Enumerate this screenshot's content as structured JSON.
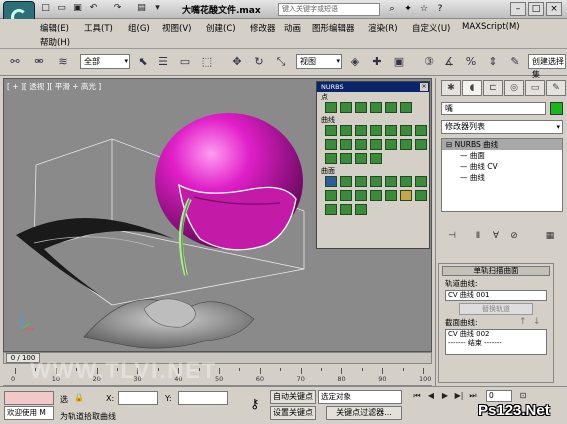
{
  "titlebar": {
    "title": "大嘴花酸文件.max",
    "search_placeholder": "键入关键字或短语"
  },
  "menu": {
    "row1": [
      "编辑(E)",
      "工具(T)",
      "组(G)",
      "视图(V)",
      "创建(C)",
      "修改器",
      "动画",
      "图形编辑器",
      "渲染(R)",
      "自定义(U)",
      "MAXScript(M)"
    ],
    "row2": [
      "帮助(H)"
    ]
  },
  "toolbar": {
    "selection_filter": "全部",
    "ref_coord": "视图",
    "named_selection": "创建选择集"
  },
  "viewport": {
    "label": "[ + ][ 透视 ][ 平滑 + 高光 ]"
  },
  "nurbs_panel": {
    "title": "NURBS",
    "section_points": "点",
    "section_curves": "曲线",
    "section_surfaces": "曲面"
  },
  "command_panel": {
    "object_name": "嘴",
    "modifier_list": "修改器列表",
    "stack": [
      "NURBS 曲线",
      "曲面",
      "曲线 CV",
      "曲线"
    ],
    "object_color": "#17b81c"
  },
  "rollout": {
    "title": "单轨扫描曲面",
    "rail_label": "轨道曲线:",
    "rail_value": "CV 曲线 001",
    "replace_rail": "替换轨道",
    "section_label": "截面曲线:",
    "section_items": [
      "CV 曲线 002",
      "------- 结束 -------"
    ]
  },
  "timeline": {
    "thumb": "0 / 100",
    "ticks": [
      "0",
      "10",
      "20",
      "30",
      "40",
      "50",
      "60",
      "70",
      "80",
      "90",
      "100"
    ]
  },
  "statusbar": {
    "welcome": "欢迎使用 M",
    "selected_label": "选",
    "x_label": "X:",
    "y_label": "Y:",
    "autokey": "自动关键点",
    "selected_object": "选定对象",
    "setkey": "设置关键点",
    "key_filters": "关键点过滤器...",
    "prompt": "为轨道拾取曲线",
    "frame": "0"
  },
  "watermarks": {
    "tlvi": "WWW.TLVI.NET",
    "site": "Ps123.Net"
  }
}
